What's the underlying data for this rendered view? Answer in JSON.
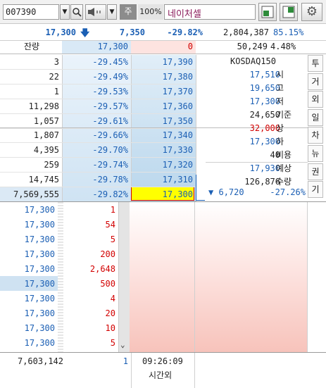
{
  "header": {
    "code": "007390",
    "tag": "주",
    "pct": "100%",
    "name": "네이처셀"
  },
  "quote": {
    "price": "17,300",
    "diff": "7,350",
    "rate": "-29.82%",
    "volume": "2,804,387",
    "vol_rate": "85.15%"
  },
  "residual": {
    "label": "잔량",
    "ask": "17,300",
    "bid": "0",
    "sum": "50,249",
    "pct": "4.48%"
  },
  "asks": [
    {
      "qty": "3",
      "rate": "-29.45%",
      "price": "17,390"
    },
    {
      "qty": "22",
      "rate": "-29.49%",
      "price": "17,380"
    },
    {
      "qty": "1",
      "rate": "-29.53%",
      "price": "17,370"
    },
    {
      "qty": "11,298",
      "rate": "-29.57%",
      "price": "17,360"
    },
    {
      "qty": "1,057",
      "rate": "-29.61%",
      "price": "17,350"
    },
    {
      "qty": "1,807",
      "rate": "-29.66%",
      "price": "17,340"
    },
    {
      "qty": "4,395",
      "rate": "-29.70%",
      "price": "17,330"
    },
    {
      "qty": "259",
      "rate": "-29.74%",
      "price": "17,320"
    },
    {
      "qty": "14,745",
      "rate": "-29.78%",
      "price": "17,310"
    },
    {
      "qty": "7,569,555",
      "rate": "-29.82%",
      "price": "17,300"
    }
  ],
  "info": [
    {
      "v": "KOSDAQ150",
      "k": ""
    },
    {
      "v": "17,510",
      "k": "시"
    },
    {
      "v": "19,650",
      "k": "고"
    },
    {
      "v": "17,300",
      "k": "저"
    },
    {
      "v": "24,650",
      "k": "기준"
    },
    {
      "v": "32,000",
      "k": "상"
    },
    {
      "v": "17,300",
      "k": "하"
    },
    {
      "v": "40",
      "k": "비용"
    },
    {
      "v": "17,930",
      "k": "예상"
    },
    {
      "v": "126,876",
      "k": "수량"
    }
  ],
  "exp": {
    "arrow": "▼",
    "val": "6,720",
    "rate": "-27.26%"
  },
  "trades": [
    {
      "price": "17,300",
      "qty": "1"
    },
    {
      "price": "17,300",
      "qty": "54"
    },
    {
      "price": "17,300",
      "qty": "5"
    },
    {
      "price": "17,300",
      "qty": "200"
    },
    {
      "price": "17,300",
      "qty": "2,648"
    },
    {
      "price": "17,300",
      "qty": "500"
    },
    {
      "price": "17,300",
      "qty": "4"
    },
    {
      "price": "17,300",
      "qty": "20"
    },
    {
      "price": "17,300",
      "qty": "10"
    },
    {
      "price": "17,300",
      "qty": "5"
    }
  ],
  "footer": {
    "total": "7,603,142",
    "count": "1",
    "time": "09:26:09",
    "session": "시간외"
  },
  "tabs": [
    "투",
    "거",
    "외",
    "일",
    "차",
    "뉴",
    "권",
    "기"
  ]
}
